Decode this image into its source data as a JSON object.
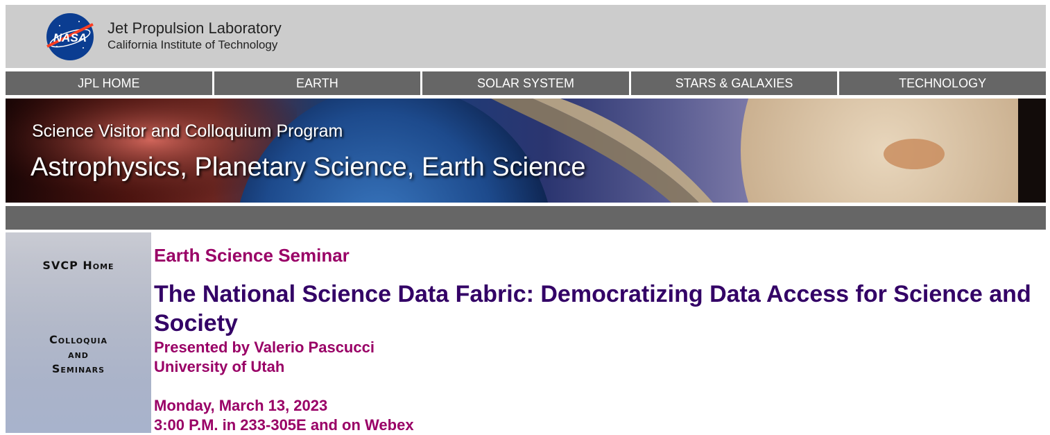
{
  "header": {
    "org_title": "Jet Propulsion Laboratory",
    "org_subtitle": "California Institute of Technology",
    "logo_text": "NASA"
  },
  "nav": {
    "items": [
      {
        "label": "JPL HOME"
      },
      {
        "label": "EARTH"
      },
      {
        "label": "SOLAR SYSTEM"
      },
      {
        "label": "STARS & GALAXIES"
      },
      {
        "label": "TECHNOLOGY"
      }
    ]
  },
  "banner": {
    "line1": "Science Visitor and Colloquium Program",
    "line2": "Astrophysics, Planetary Science, Earth Science"
  },
  "sidebar": {
    "home": "SVCP Home",
    "colloquia_line1": "Colloquia",
    "colloquia_line2": "and",
    "colloquia_line3": "Seminars"
  },
  "main": {
    "seminar_type": "Earth Science Seminar",
    "title": "The National Science Data Fabric: Democratizing Data Access for Science and Society",
    "presenter": "Presented by Valerio Pascucci",
    "affiliation": "University of Utah",
    "date": "Monday, March 13, 2023",
    "time_location": "3:00 P.M. in 233-305E and on Webex"
  },
  "colors": {
    "header_bg": "#cccccc",
    "nav_bg": "#666666",
    "seminar_color": "#990066",
    "title_color": "#330066"
  }
}
